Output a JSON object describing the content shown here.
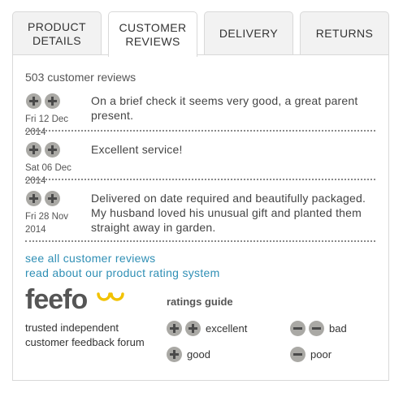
{
  "tabs": [
    {
      "label": "PRODUCT\nDETAILS",
      "active": false
    },
    {
      "label": "CUSTOMER\nREVIEWS",
      "active": true
    },
    {
      "label": "DELIVERY",
      "active": false
    },
    {
      "label": "RETURNS",
      "active": false
    }
  ],
  "reviews_count": "503 customer reviews",
  "reviews": [
    {
      "rating": 2,
      "date": "Fri 12 Dec 2014",
      "text": "On a brief check it seems very good, a great parent present."
    },
    {
      "rating": 2,
      "date": "Sat 06 Dec 2014",
      "text": "Excellent service!"
    },
    {
      "rating": 2,
      "date": "Fri 28 Nov 2014",
      "text": "Delivered on date required and beautifully packaged. My husband loved his unusual gift and planted them straight away in garden."
    }
  ],
  "links": {
    "see_all": "see all customer reviews",
    "rating_system": "read about our product rating system"
  },
  "feefo": {
    "logo_text": "feefo",
    "tagline": "trusted independent customer feedback forum"
  },
  "ratings_guide": {
    "title": "ratings guide",
    "items": [
      {
        "label": "excellent",
        "symbol": "plus",
        "count": 2
      },
      {
        "label": "bad",
        "symbol": "minus",
        "count": 2
      },
      {
        "label": "good",
        "symbol": "plus",
        "count": 1
      },
      {
        "label": "poor",
        "symbol": "minus",
        "count": 1
      }
    ]
  },
  "colors": {
    "link": "#2f8fb5",
    "logo_accent": "#f2c200",
    "icon_fill": "#aaa9a5"
  }
}
